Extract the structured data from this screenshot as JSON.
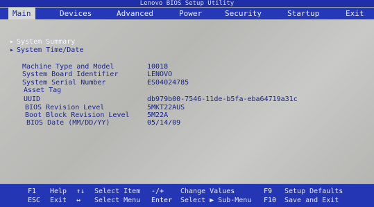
{
  "title": "Lenovo BIOS Setup Utility",
  "tabs": [
    {
      "label": "Main"
    },
    {
      "label": "Devices"
    },
    {
      "label": "Advanced"
    },
    {
      "label": "Power"
    },
    {
      "label": "Security"
    },
    {
      "label": "Startup"
    },
    {
      "label": "Exit"
    }
  ],
  "menu": [
    {
      "label": "System Summary",
      "selected": true
    },
    {
      "label": "System Time/Date",
      "selected": false
    }
  ],
  "info": [
    {
      "label": "Machine Type and Model",
      "value": "10018"
    },
    {
      "label": "System Board Identifier",
      "value": "LENOVO"
    },
    {
      "label": "System Serial Number",
      "value": "ES04024785"
    },
    {
      "label": "Asset Tag",
      "value": ""
    },
    {
      "label": "UUID",
      "value": "db979b00-7546-11de-b5fa-eba64719a31c"
    },
    {
      "label": "BIOS Revision Level",
      "value": "5MKT22AUS"
    },
    {
      "label": "Boot Block Revision Level",
      "value": "5M22A"
    },
    {
      "label": "BIOS Date (MM/DD/YY)",
      "value": "05/14/09"
    }
  ],
  "footer": {
    "f1_key": "F1",
    "f1_text": "Help",
    "updown_key": "↑↓",
    "updown_text": "Select Item",
    "pm_key": "-/+",
    "pm_text": "Change Values",
    "f9_key": "F9",
    "f9_text": "Setup Defaults",
    "esc_key": "ESC",
    "esc_text": "Exit",
    "lr_key": "↔",
    "lr_text": "Select Menu",
    "enter_key": "Enter",
    "enter_text": "Select ▶ Sub-Menu",
    "f10_key": "F10",
    "f10_text": "Save and Exit"
  },
  "colors": {
    "accent": "#2438b8",
    "background": "#a9aba8",
    "text": "#1a2499"
  }
}
